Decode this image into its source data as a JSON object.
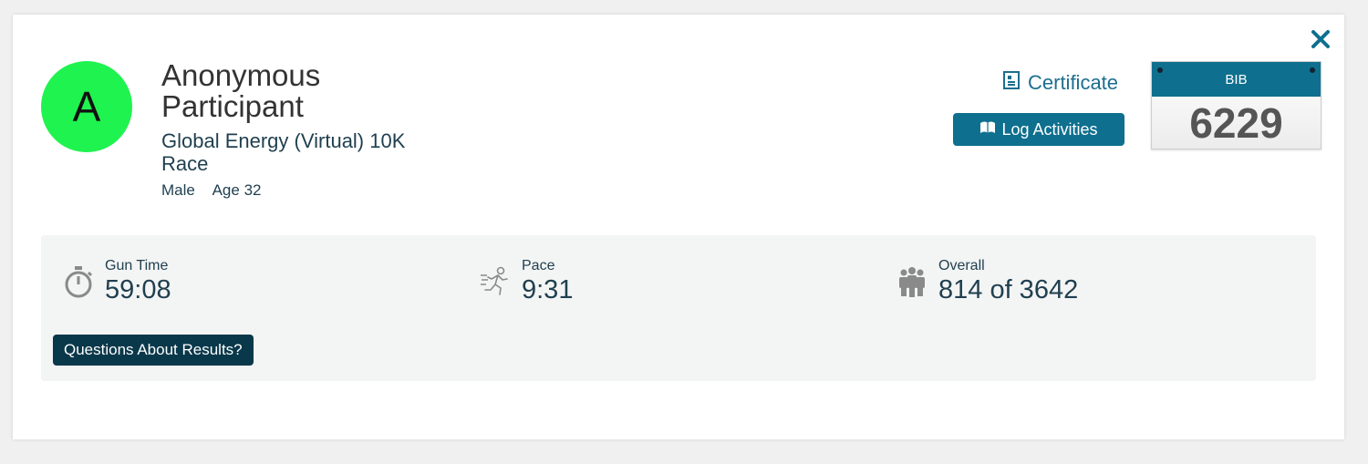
{
  "participant": {
    "initial": "A",
    "name": "Anonymous Participant",
    "event": "Global Energy (Virtual) 10K Race",
    "gender": "Male",
    "age": "Age 32"
  },
  "actions": {
    "certificate_label": "Certificate",
    "log_activities_label": "Log Activities"
  },
  "bib": {
    "label": "BIB",
    "number": "6229"
  },
  "stats": {
    "gun_time": {
      "label": "Gun Time",
      "value": "59:08",
      "icon": "stopwatch-icon"
    },
    "pace": {
      "label": "Pace",
      "value": "9:31",
      "icon": "runner-icon"
    },
    "overall": {
      "label": "Overall",
      "value": "814 of 3642",
      "icon": "people-icon"
    }
  },
  "questions_label": "Questions About Results?",
  "colors": {
    "avatar": "#1ff34f",
    "accent": "#0e6f8e",
    "dark_button": "#09384a"
  }
}
